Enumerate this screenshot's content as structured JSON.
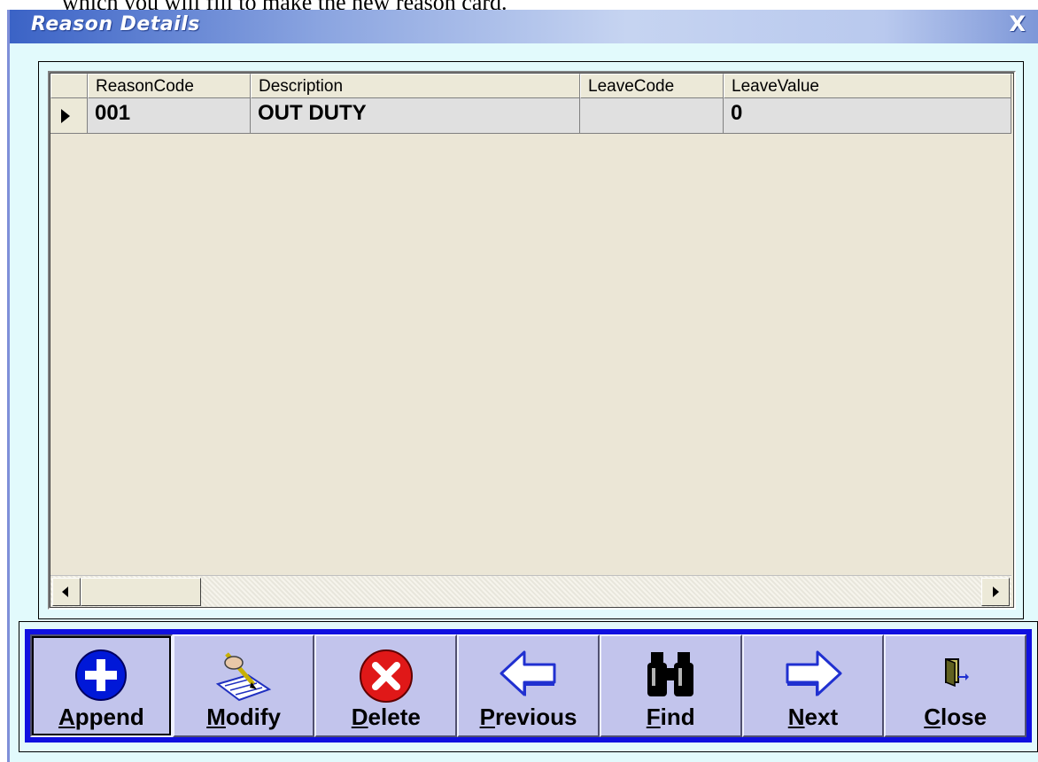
{
  "document_text": "which you will fill to make the new reason card.",
  "window": {
    "title": "Reason Details",
    "close_glyph": "X"
  },
  "grid": {
    "columns": [
      "ReasonCode",
      "Description",
      "LeaveCode",
      "LeaveValue"
    ],
    "rows": [
      {
        "ReasonCode": "001",
        "Description": "OUT DUTY",
        "LeaveCode": "",
        "LeaveValue": "0"
      }
    ]
  },
  "toolbar": {
    "buttons": [
      {
        "mnemonic": "A",
        "rest": "ppend",
        "icon": "plus-circle-icon",
        "color": "#0018d8"
      },
      {
        "mnemonic": "M",
        "rest": "odify",
        "icon": "pen-notepad-icon",
        "color": "#2030c0"
      },
      {
        "mnemonic": "D",
        "rest": "elete",
        "icon": "x-circle-icon",
        "color": "#e01818"
      },
      {
        "mnemonic": "P",
        "rest": "revious",
        "icon": "arrow-left-icon",
        "color": "#2030d0"
      },
      {
        "mnemonic": "F",
        "rest": "ind",
        "icon": "binoculars-icon",
        "color": "#000000"
      },
      {
        "mnemonic": "N",
        "rest": "ext",
        "icon": "arrow-right-icon",
        "color": "#2030d0"
      },
      {
        "mnemonic": "C",
        "rest": "lose",
        "icon": "door-exit-icon",
        "color": "#606020"
      }
    ]
  },
  "colors": {
    "window_bg": "#e2fafc",
    "toolbar_bg": "#1010e0",
    "button_bg": "#c2c4ec",
    "grid_bg": "#ebe6d6"
  }
}
